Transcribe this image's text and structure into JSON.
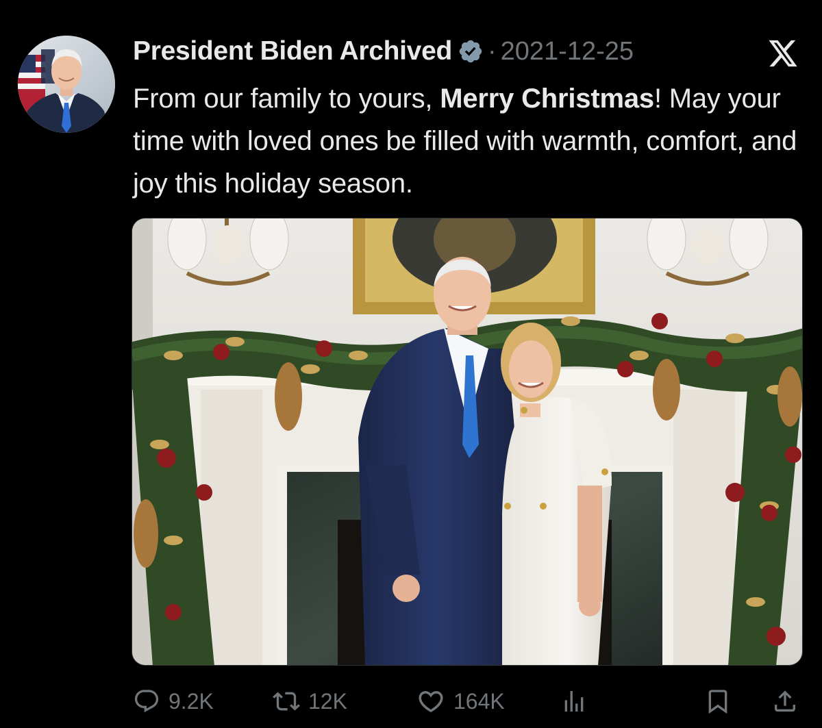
{
  "tweet": {
    "author_name": "President Biden Archived",
    "separator": "·",
    "date": "2021-12-25",
    "text_part1": "From our family to yours, ",
    "text_bold": "Merry Christmas",
    "text_part2": "! May your time with loved ones be filled with warmth, comfort, and joy this holiday season."
  },
  "stats": {
    "replies": "9.2K",
    "reposts": "12K",
    "likes": "164K"
  },
  "icons": {
    "verified": "verified-badge-icon",
    "platform": "x-logo-icon",
    "reply": "reply-icon",
    "repost": "repost-icon",
    "like": "heart-icon",
    "views": "views-icon",
    "bookmark": "bookmark-icon",
    "share": "share-icon"
  },
  "colors": {
    "background": "#000000",
    "text": "#e7e9ea",
    "muted": "#71767b",
    "verified_badge": "#829aab"
  }
}
